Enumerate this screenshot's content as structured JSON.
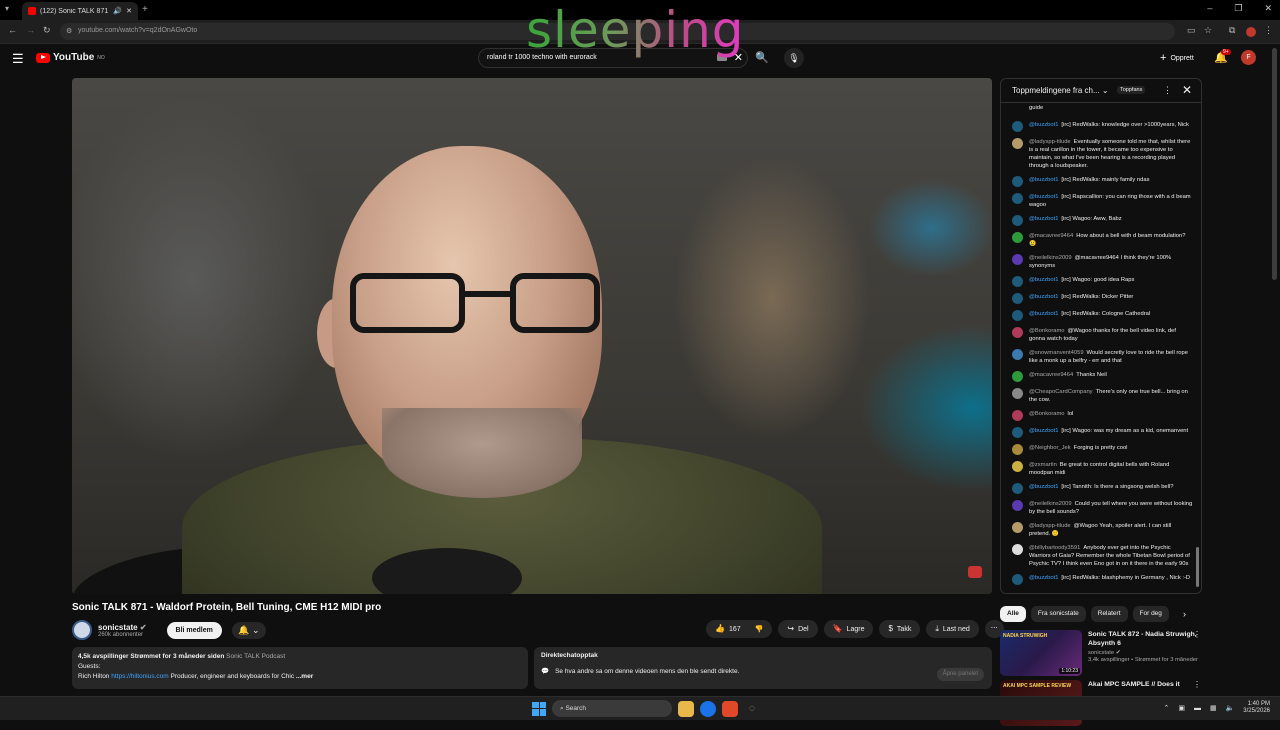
{
  "browser": {
    "tab_title": "(122) Sonic TALK 871 - Wal",
    "new_tab": "+",
    "url": "youtube.com/watch?v=q2dOnAGwOto",
    "win_controls": [
      "–",
      "❐",
      "✕"
    ]
  },
  "youtube": {
    "logo_text": "YouTube",
    "region": "NO",
    "search_value": "roland tr 1000 techno with eurorack",
    "create_label": "Opprett",
    "notif_count": "9+",
    "avatar_letter": "F"
  },
  "overlay": {
    "word": "sleeping"
  },
  "video": {
    "title": "Sonic TALK 871 - Waldorf Protein, Bell Tuning, CME H12 MIDI pro",
    "channel": "sonicstate",
    "subscribers": "260k abonnenter",
    "join_label": "Bli medlem",
    "likes": "167",
    "share_label": "Del",
    "save_label": "Lagre",
    "thanks_label": "Takk",
    "download_label": "Last ned"
  },
  "description": {
    "stats": "4,5k avspillinger  Strømmet for 3 måneder siden",
    "tag": "Sonic TALK Podcast",
    "line2": "Guests:",
    "line3_pre": "Rich Hilton ",
    "line3_link": "https://hiltonius.com",
    "line3_post": " Producer, engineer and keyboards for Chic",
    "more": "...mer"
  },
  "replay": {
    "header": "Direktechatopptak",
    "text": "Se hva andre sa om denne videoen mens den ble sendt direkte.",
    "button": "Åpne panelet"
  },
  "chat": {
    "header": "Toppmeldingene fra ch...",
    "top_badge": "Toppfans",
    "top_fragment": "guide",
    "messages": [
      {
        "author": "@buzzbot1",
        "text": "[irc] RedWalks: knowledge over >1000years, Nick",
        "color": "#1e5a7a"
      },
      {
        "author": "@ladyspp-tilude",
        "text": "Eventually someone told me that, whilst there is a real carillon in the tower, it became too expensive to maintain, so what I've been hearing is a recording played through a loudspeaker.",
        "color": "#b59a6a"
      },
      {
        "author": "@buzzbot1",
        "text": "[irc] RedWalks: mainly family ndas",
        "color": "#1e5a7a"
      },
      {
        "author": "@buzzbot1",
        "text": "[irc] Rapscallion: you can ring those with a d beam wagoo",
        "color": "#1e5a7a"
      },
      {
        "author": "@buzzbot1",
        "text": "[irc] Wagoo: Aww, Babz",
        "color": "#1e5a7a"
      },
      {
        "author": "@macavree9464",
        "text": "How about a bell with d beam modulation? 😢",
        "color": "#2e9b3a"
      },
      {
        "author": "@neilelkins2009",
        "text": "@macavree9464 I think they're 100% synonyms",
        "color": "#5a3ab0"
      },
      {
        "author": "@buzzbot1",
        "text": "[irc] Wagoo: good idea Raps",
        "color": "#1e5a7a"
      },
      {
        "author": "@buzzbot1",
        "text": "[irc] RedWalks: Dicker Pitter",
        "color": "#1e5a7a"
      },
      {
        "author": "@buzzbot1",
        "text": "[irc] RedWalks: Cologne Cathedral",
        "color": "#1e5a7a"
      },
      {
        "author": "@Bonkoramo",
        "text": "@Wagoo thanks for the bell video link, def gonna watch today",
        "color": "#b03a5a"
      },
      {
        "author": "@snowmanvent4059",
        "text": "Would secretly love to ride the bell rope like a monk up a belfry - err and that",
        "color": "#3a7ab0"
      },
      {
        "author": "@macavree9464",
        "text": "Thanks Neil",
        "color": "#2e9b3a"
      },
      {
        "author": "@CheapoCardCompany",
        "text": "There's only one true bell... bring on the cow.",
        "color": "#888888"
      },
      {
        "author": "@Bonkoramo",
        "text": "lol",
        "color": "#b03a5a"
      },
      {
        "author": "@buzzbot1",
        "text": "[irc] Wagoo: was my dream as a kid, onemanvent",
        "color": "#1e5a7a"
      },
      {
        "author": "@Neighbor_Jek",
        "text": "Forging is pretty cool",
        "color": "#a88a3a"
      },
      {
        "author": "@zxmartin",
        "text": "Be great to control digital bells with Roland moodpan midi",
        "color": "#c9b040"
      },
      {
        "author": "@buzzbot1",
        "text": "[irc] Tannith: Is there a singsong welsh bell?",
        "color": "#1e5a7a"
      },
      {
        "author": "@neilelkins2009",
        "text": "Could you tell where you were without looking by the bell sounds?",
        "color": "#5a3ab0"
      },
      {
        "author": "@ladyspp-tilude",
        "text": "@Wagoo Yeah, spoiler alert. I can still pretend. 🙂",
        "color": "#b59a6a"
      },
      {
        "author": "@billybartoody3591",
        "text": "Anybody ever get into the Psychic Warriors of Gaia? Remember the whole Tibetan Bowl period of Psychic TV? I think even Eno got in on it there in the early 90s",
        "color": "#dddddd"
      },
      {
        "author": "@buzzbot1",
        "text": "[irc] RedWalks: blashphemy in Germany , Nick :-D",
        "color": "#1e5a7a"
      }
    ]
  },
  "chips": [
    "Alle",
    "Fra sonicstate",
    "Relatert",
    "For deg"
  ],
  "recommendations": [
    {
      "thumb_text": "NADIA STRUWIGH",
      "duration": "1:10:23",
      "title": "Sonic TALK 872 - Nadia Struwigh, Absynth 6",
      "channel": "sonicstate",
      "meta": "3,4k avspillinger • Strømmet for 3 måneder siden"
    },
    {
      "thumb_text": "AKAI MPC SAMPLE   REVIEW",
      "duration": "",
      "title": "Akai MPC SAMPLE // Does it",
      "channel": "",
      "meta": ""
    }
  ],
  "taskbar": {
    "search": "Search",
    "time": "1:40 PM",
    "date": "3/25/2026"
  }
}
